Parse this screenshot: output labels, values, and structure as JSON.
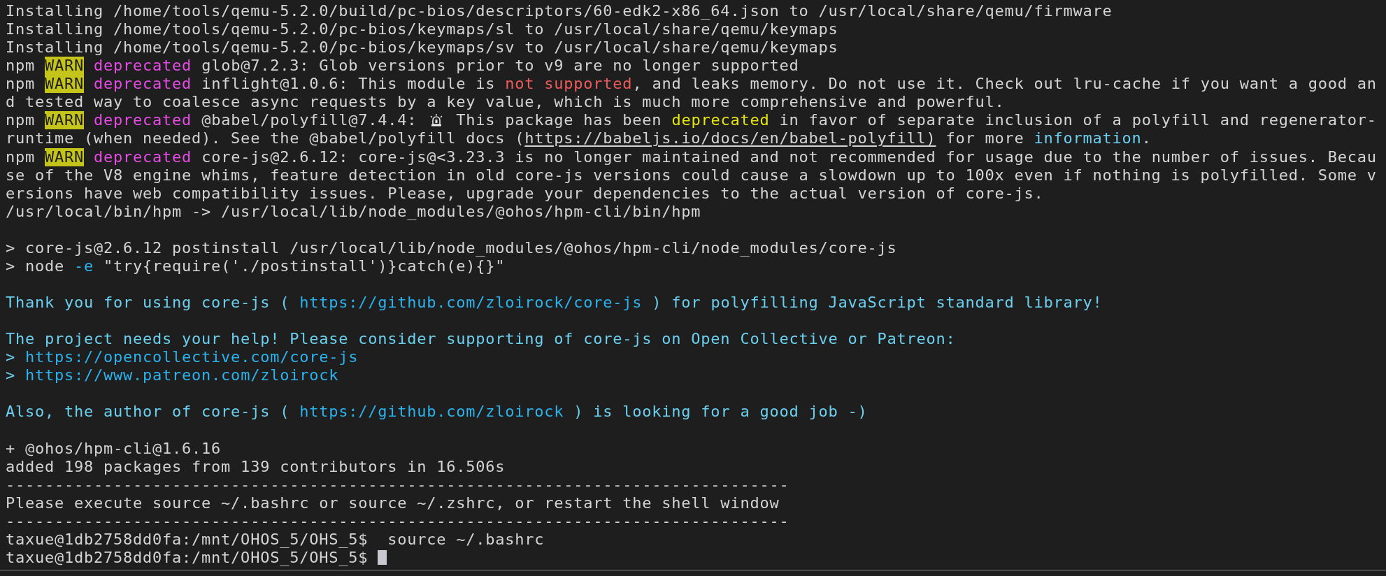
{
  "terminal": {
    "lines": [
      {
        "kind": "text",
        "segments": [
          {
            "kind": "plain",
            "text": "Installing /home/tools/qemu-5.2.0/build/pc-bios/descriptors/60-edk2-x86_64.json to /usr/local/share/qemu/firmware"
          }
        ]
      },
      {
        "kind": "text",
        "segments": [
          {
            "kind": "plain",
            "text": "Installing /home/tools/qemu-5.2.0/pc-bios/keymaps/sl to /usr/local/share/qemu/keymaps"
          }
        ]
      },
      {
        "kind": "text",
        "segments": [
          {
            "kind": "plain",
            "text": "Installing /home/tools/qemu-5.2.0/pc-bios/keymaps/sv to /usr/local/share/qemu/keymaps"
          }
        ]
      },
      {
        "kind": "text",
        "segments": [
          {
            "kind": "plain",
            "text": "npm "
          },
          {
            "kind": "warn",
            "text": "WARN"
          },
          {
            "kind": "magenta",
            "text": " deprecated"
          },
          {
            "kind": "plain",
            "text": " glob@7.2.3: Glob versions prior to v9 are no longer supported"
          }
        ]
      },
      {
        "kind": "text",
        "segments": [
          {
            "kind": "plain",
            "text": "npm "
          },
          {
            "kind": "warn",
            "text": "WARN"
          },
          {
            "kind": "magenta",
            "text": " deprecated"
          },
          {
            "kind": "plain",
            "text": " inflight@1.0.6: This module is "
          },
          {
            "kind": "red",
            "text": "not supported"
          },
          {
            "kind": "plain",
            "text": ", and leaks memory. Do not use it. Check out lru-cache if you want a good an"
          }
        ]
      },
      {
        "kind": "text",
        "segments": [
          {
            "kind": "plain",
            "text": "d tested way to coalesce async requests by a key value, which is much more comprehensive and powerful."
          }
        ]
      },
      {
        "kind": "text",
        "segments": [
          {
            "kind": "plain",
            "text": "npm "
          },
          {
            "kind": "warn",
            "text": "WARN"
          },
          {
            "kind": "magenta",
            "text": " deprecated"
          },
          {
            "kind": "plain",
            "text": " @babel/polyfill@7.4.4: "
          },
          {
            "kind": "icon"
          },
          {
            "kind": "plain",
            "text": " This package has been "
          },
          {
            "kind": "yellow",
            "text": "deprecated"
          },
          {
            "kind": "plain",
            "text": " in favor of separate inclusion of a polyfill and regenerator-"
          }
        ]
      },
      {
        "kind": "text",
        "segments": [
          {
            "kind": "plain",
            "text": "runtime (when needed). See the @babel/polyfill docs ("
          },
          {
            "kind": "underline",
            "text": "https://babeljs.io/docs/en/babel-polyfill)"
          },
          {
            "kind": "plain",
            "text": " for more "
          },
          {
            "kind": "cyan",
            "text": "information"
          },
          {
            "kind": "plain",
            "text": "."
          }
        ]
      },
      {
        "kind": "text",
        "segments": [
          {
            "kind": "plain",
            "text": "npm "
          },
          {
            "kind": "warn",
            "text": "WARN"
          },
          {
            "kind": "magenta",
            "text": " deprecated"
          },
          {
            "kind": "plain",
            "text": " core-js@2.6.12: core-js@<3.23.3 is no longer maintained and not recommended for usage due to the number of issues. Becau"
          }
        ]
      },
      {
        "kind": "text",
        "segments": [
          {
            "kind": "plain",
            "text": "se of the V8 engine whims, feature detection in old core-js versions could cause a slowdown up to 100x even if nothing is polyfilled. Some v"
          }
        ]
      },
      {
        "kind": "text",
        "segments": [
          {
            "kind": "plain",
            "text": "ersions have web compatibility issues. Please, upgrade your dependencies to the actual version of core-js."
          }
        ]
      },
      {
        "kind": "text",
        "segments": [
          {
            "kind": "plain",
            "text": "/usr/local/bin/hpm -> /usr/local/lib/node_modules/@ohos/hpm-cli/bin/hpm"
          }
        ]
      },
      {
        "kind": "blank"
      },
      {
        "kind": "text",
        "segments": [
          {
            "kind": "plain",
            "text": "> core-js@2.6.12 postinstall /usr/local/lib/node_modules/@ohos/hpm-cli/node_modules/core-js"
          }
        ]
      },
      {
        "kind": "text",
        "segments": [
          {
            "kind": "plain",
            "text": "> node "
          },
          {
            "kind": "blue",
            "text": "-e"
          },
          {
            "kind": "plain",
            "text": " \"try{require('./postinstall')}catch(e){}\""
          }
        ]
      },
      {
        "kind": "blank"
      },
      {
        "kind": "text",
        "segments": [
          {
            "kind": "cyan",
            "text": "Thank you for using core-js ( "
          },
          {
            "kind": "blue",
            "text": "https://github.com/zloirock/core-js"
          },
          {
            "kind": "cyan",
            "text": " ) for polyfilling JavaScript standard library!"
          }
        ]
      },
      {
        "kind": "blank"
      },
      {
        "kind": "text",
        "segments": [
          {
            "kind": "cyan",
            "text": "The project needs your help! Please consider supporting of core-js on Open Collective or Patreon:"
          }
        ]
      },
      {
        "kind": "text",
        "segments": [
          {
            "kind": "cyan",
            "text": "> "
          },
          {
            "kind": "blue",
            "text": "https://opencollective.com/core-js"
          }
        ]
      },
      {
        "kind": "text",
        "segments": [
          {
            "kind": "cyan",
            "text": "> "
          },
          {
            "kind": "blue",
            "text": "https://www.patreon.com/zloirock"
          }
        ]
      },
      {
        "kind": "blank"
      },
      {
        "kind": "text",
        "segments": [
          {
            "kind": "cyan",
            "text": "Also, the author of core-js ( "
          },
          {
            "kind": "blue",
            "text": "https://github.com/zloirock"
          },
          {
            "kind": "cyan",
            "text": " ) is looking for a good job -)"
          }
        ]
      },
      {
        "kind": "blank"
      },
      {
        "kind": "text",
        "segments": [
          {
            "kind": "plain",
            "text": "+ @ohos/hpm-cli@1.6.16"
          }
        ]
      },
      {
        "kind": "text",
        "segments": [
          {
            "kind": "plain",
            "text": "added 198 packages from 139 contributors in 16.506s"
          }
        ]
      },
      {
        "kind": "text",
        "segments": [
          {
            "kind": "plain",
            "text": "--------------------------------------------------------------------------------"
          }
        ]
      },
      {
        "kind": "text",
        "segments": [
          {
            "kind": "plain",
            "text": "Please execute source ~/.bashrc or source ~/.zshrc, or restart the shell window"
          }
        ]
      },
      {
        "kind": "text",
        "segments": [
          {
            "kind": "plain",
            "text": "--------------------------------------------------------------------------------"
          }
        ]
      },
      {
        "kind": "text",
        "segments": [
          {
            "kind": "plain",
            "text": "taxue@1db2758dd0fa:/mnt/OHOS_5/OHS_5$  source ~/.bashrc"
          }
        ]
      },
      {
        "kind": "text",
        "cursor": true,
        "segments": [
          {
            "kind": "plain",
            "text": "taxue@1db2758dd0fa:/mnt/OHOS_5/OHS_5$ "
          }
        ]
      }
    ]
  }
}
